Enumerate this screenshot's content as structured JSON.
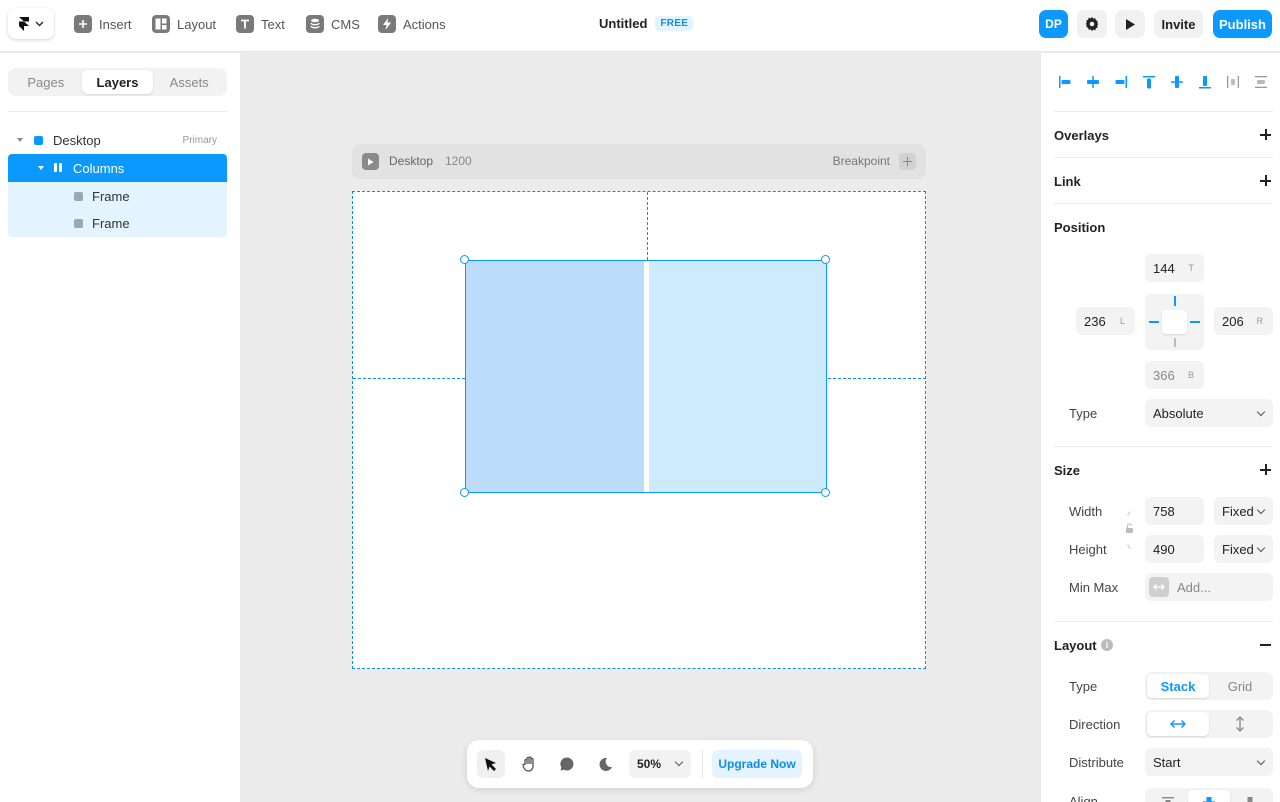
{
  "toolbar": {
    "insert": "Insert",
    "layout": "Layout",
    "text": "Text",
    "cms": "CMS",
    "actions": "Actions"
  },
  "document": {
    "title": "Untitled",
    "plan_badge": "FREE"
  },
  "header_right": {
    "avatar_initials": "DP",
    "invite_label": "Invite",
    "publish_label": "Publish"
  },
  "left_panel": {
    "tabs": [
      {
        "label": "Pages",
        "active": false
      },
      {
        "label": "Layers",
        "active": true
      },
      {
        "label": "Assets",
        "active": false
      }
    ],
    "layers": [
      {
        "name": "Desktop",
        "tag": "Primary"
      },
      {
        "name": "Columns",
        "selected": true
      },
      {
        "name": "Frame"
      },
      {
        "name": "Frame"
      }
    ]
  },
  "canvas": {
    "frame_name": "Desktop",
    "frame_width": "1200",
    "breakpoint_label": "Breakpoint",
    "selected_layer": "Columns"
  },
  "bottombar": {
    "zoom": "50%",
    "upgrade_label": "Upgrade Now"
  },
  "right_panel": {
    "sections": {
      "overlays": "Overlays",
      "link": "Link",
      "position": "Position",
      "size": "Size",
      "layout": "Layout"
    },
    "position": {
      "top": "144",
      "top_suffix": "T",
      "left": "236",
      "left_suffix": "L",
      "right": "206",
      "right_suffix": "R",
      "bottom": "366",
      "bottom_suffix": "B",
      "type_label": "Type",
      "type_value": "Absolute"
    },
    "size": {
      "width_label": "Width",
      "width_value": "758",
      "width_mode": "Fixed",
      "height_label": "Height",
      "height_value": "490",
      "height_mode": "Fixed",
      "minmax_label": "Min Max",
      "minmax_placeholder": "Add..."
    },
    "layout": {
      "type_label": "Type",
      "type_options": [
        "Stack",
        "Grid"
      ],
      "type_selected": "Stack",
      "direction_label": "Direction",
      "distribute_label": "Distribute",
      "distribute_value": "Start",
      "align_label": "Align"
    }
  },
  "colors": {
    "accent": "#0C99FF",
    "column_a": "#BCDCFB",
    "column_b": "#CDEBFC"
  }
}
